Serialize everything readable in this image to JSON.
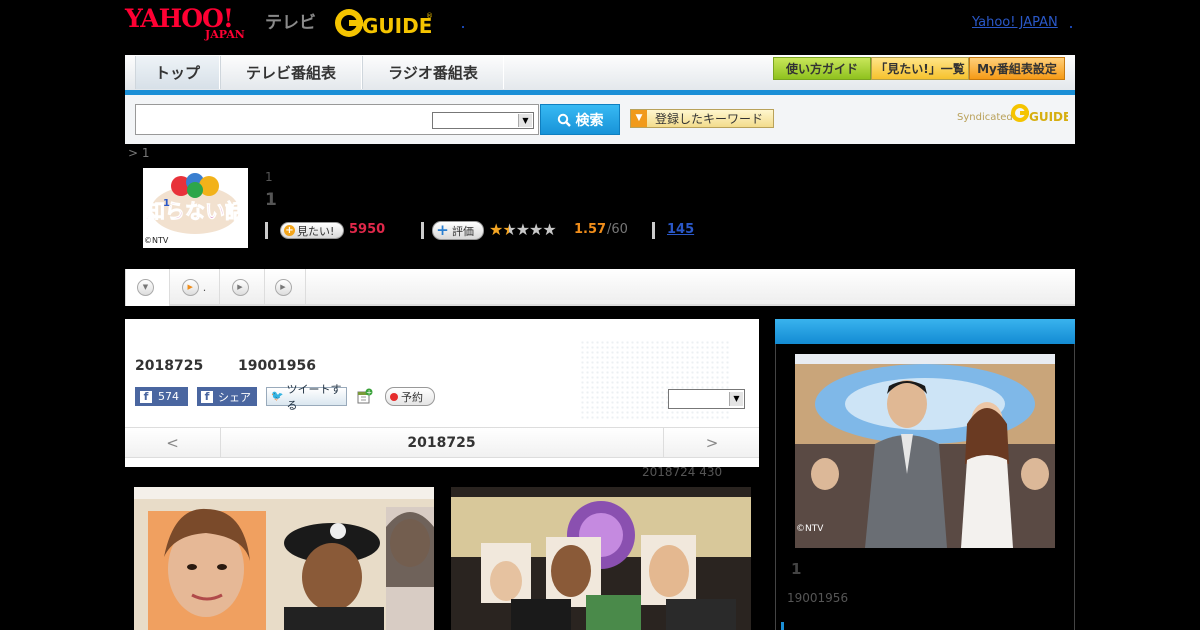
{
  "header": {
    "yahoo_logo": "YAHOO!",
    "yahoo_japan": "JAPAN",
    "tv_label": "テレビ",
    "gguide_logo": "G-GUIDE",
    "yahoo_japan_link": "Yahoo! JAPAN"
  },
  "nav": {
    "tabs": [
      {
        "label": "トップ"
      },
      {
        "label": "テレビ番組表"
      },
      {
        "label": "ラジオ番組表"
      }
    ],
    "buttons": [
      {
        "label": "使い方ガイド"
      },
      {
        "label": "「見たい!」一覧"
      },
      {
        "label": "My番組表設定"
      }
    ]
  },
  "search": {
    "input_value": "",
    "select_value": "",
    "button_label": "検索",
    "keyword_button": "登録したキーワード",
    "syndicated": "Syndicated"
  },
  "breadcrumb": "> 1",
  "program": {
    "thumb_credit": "©NTV",
    "subtitle": "1",
    "title": "1",
    "mitai_label": "見たい!",
    "mitai_count": "5950",
    "hyoka_label": "評価",
    "stars_filled": 1.5,
    "rating": "1.57",
    "rating_max": "/60",
    "review_count": "145"
  },
  "tabs": [
    {
      "label": ""
    },
    {
      "label": "."
    },
    {
      "label": ""
    },
    {
      "label": ""
    }
  ],
  "episode": {
    "date": "2018725",
    "time": "19001956",
    "fb_like_count": "574",
    "fb_share": "シェア",
    "tweet": "ツイートする",
    "yoyaku": "予約",
    "select_value": "",
    "nav_prev": "<",
    "nav_date": "2018725",
    "nav_next": ">",
    "updated": "2018724  430"
  },
  "side": {
    "photo_credit": "©NTV",
    "title": "1",
    "time": "19001956"
  },
  "colors": {
    "accent_blue": "#1b8fd6",
    "mitai_red": "#e0284a",
    "rating_orange": "#f08d1a"
  }
}
